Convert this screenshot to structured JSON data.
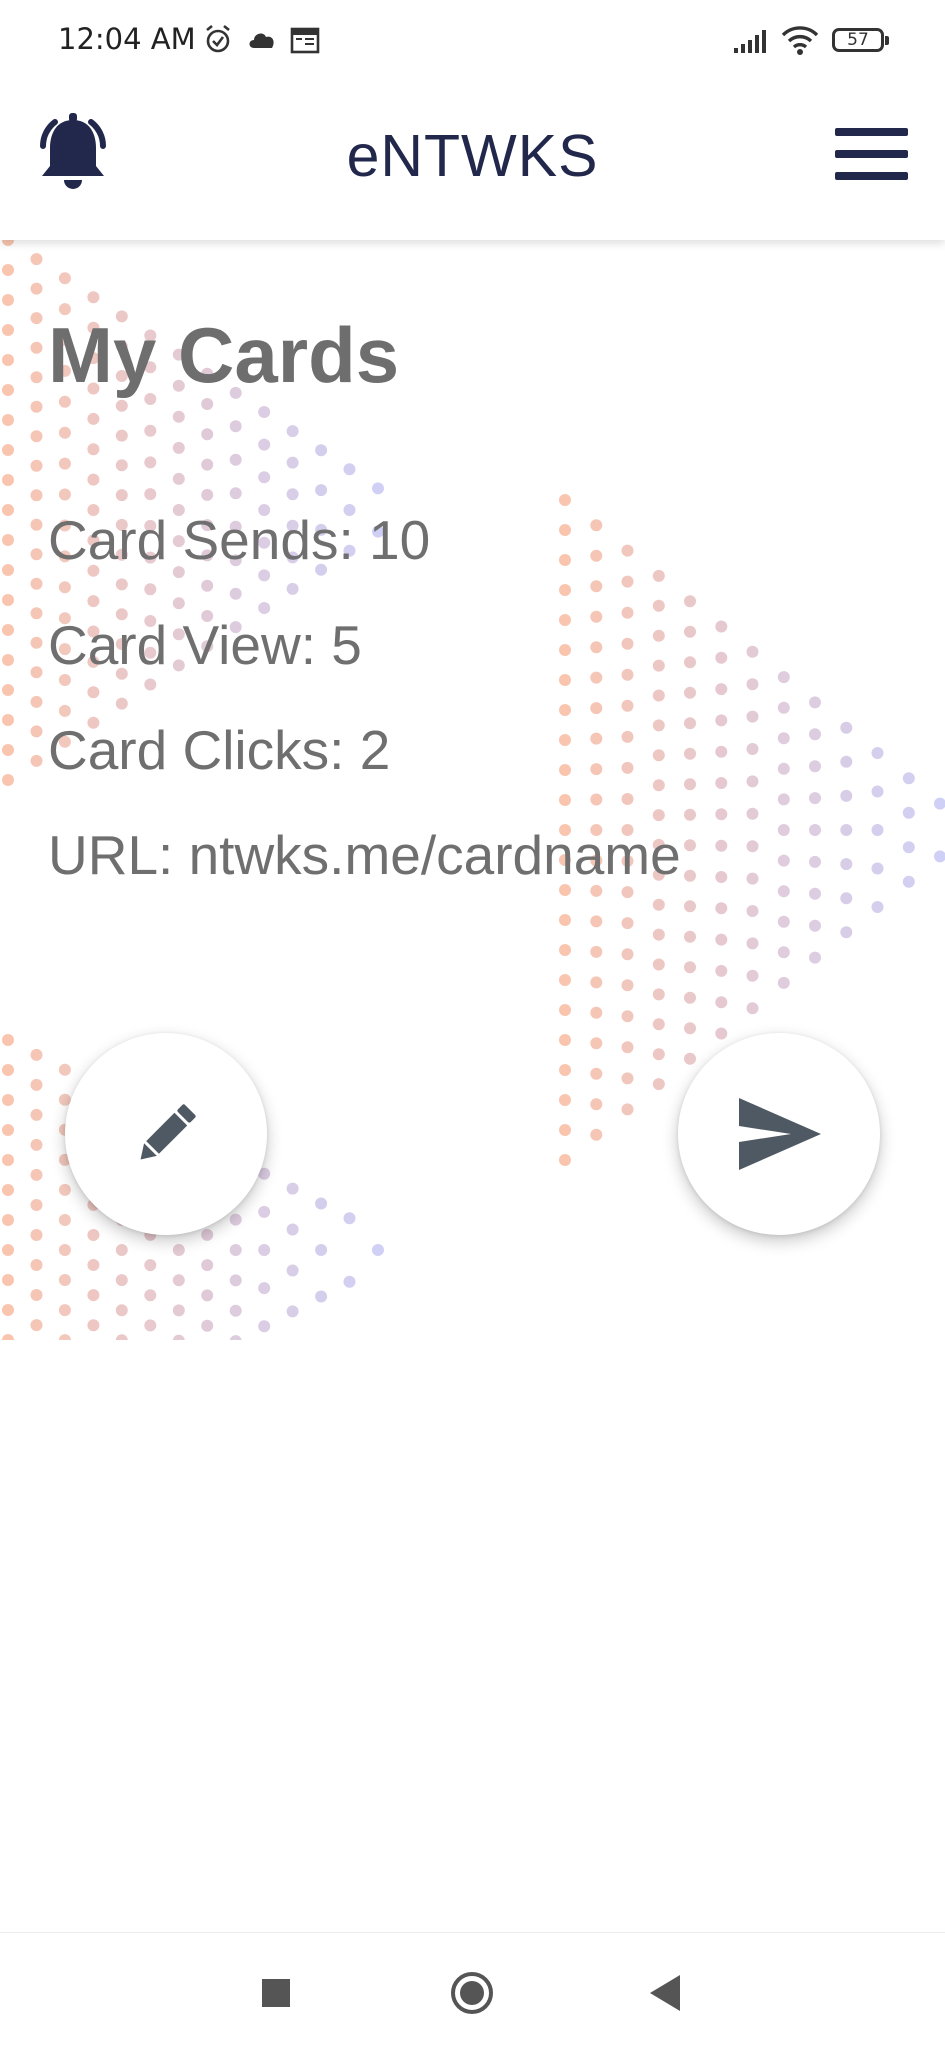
{
  "status_bar": {
    "time": "12:04 AM",
    "battery_level": "57",
    "icons": [
      "alarm-icon",
      "cloud-icon",
      "calendar-icon",
      "signal-icon",
      "wifi-icon",
      "battery-icon"
    ]
  },
  "app_bar": {
    "title": "eNTWKS",
    "left_icon": "bell-icon",
    "right_icon": "hamburger-menu-icon",
    "brand_color": "#22284b"
  },
  "main": {
    "title": "My Cards",
    "stats": {
      "sends": "Card Sends: 10",
      "views": "Card View: 5",
      "clicks": "Card Clicks: 2",
      "url": "URL: ntwks.me/cardname"
    },
    "actions": {
      "edit_icon": "pencil-icon",
      "send_icon": "send-icon"
    },
    "text_color": "#6f6f6f",
    "icon_color": "#4f5964"
  },
  "nav_bar": {
    "buttons": [
      "recents-square-icon",
      "home-circle-icon",
      "back-triangle-icon"
    ]
  }
}
